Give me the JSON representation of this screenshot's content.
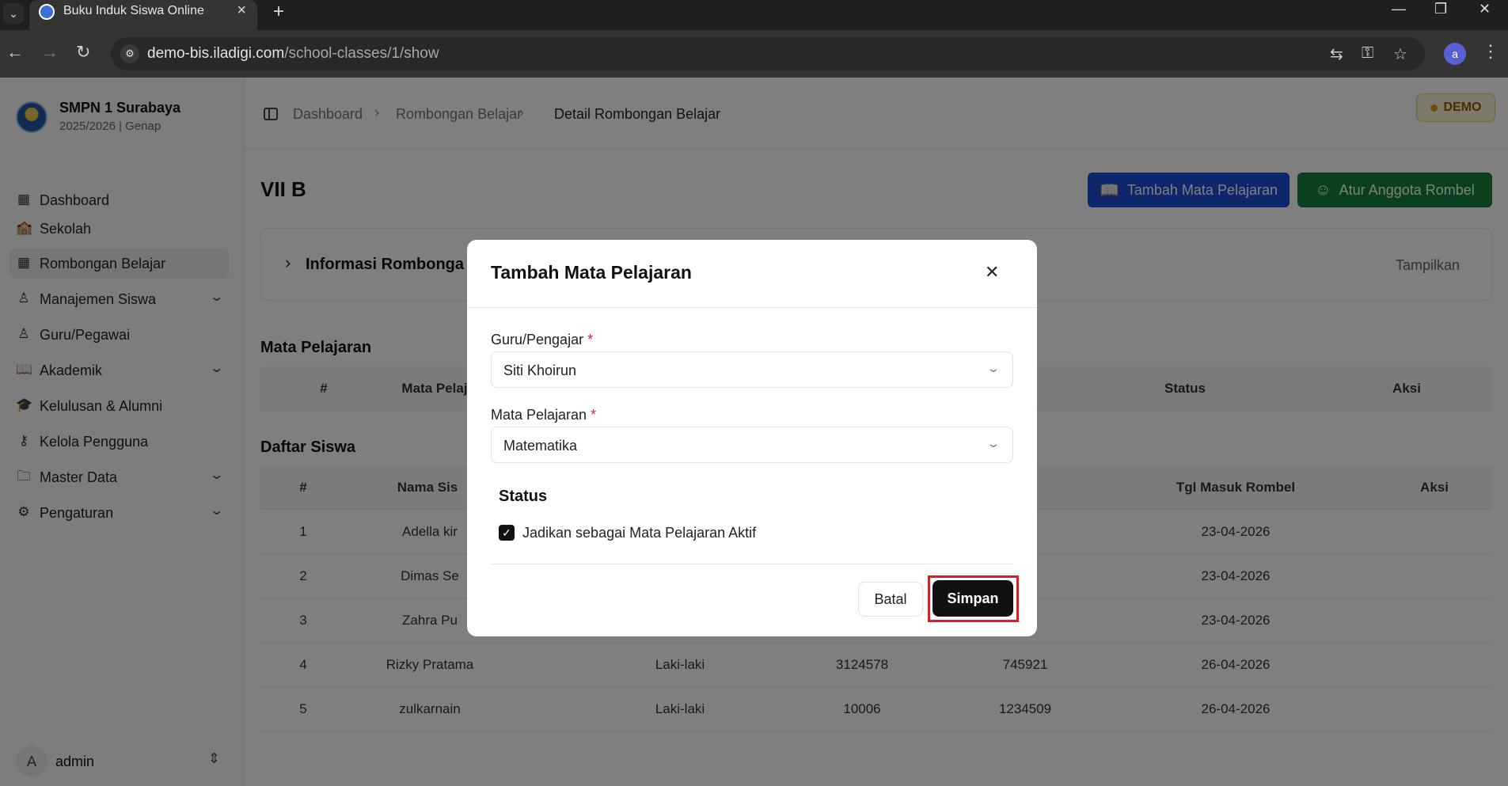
{
  "browser": {
    "tab_title": "Buku Induk Siswa Online",
    "url_host": "demo-bis.iladigi.com",
    "url_path": "/school-classes/1/show",
    "profile_initial": "a"
  },
  "sidebar": {
    "school_name": "SMPN 1 Surabaya",
    "school_year": "2025/2026 | Genap",
    "items": [
      {
        "label": "Dashboard",
        "icon": "grid-icon"
      },
      {
        "label": "Sekolah",
        "icon": "school-icon"
      },
      {
        "label": "Rombongan Belajar",
        "icon": "grid-icon"
      },
      {
        "label": "Manajemen Siswa",
        "icon": "user-icon"
      },
      {
        "label": "Guru/Pegawai",
        "icon": "users-icon"
      },
      {
        "label": "Akademik",
        "icon": "book-icon"
      },
      {
        "label": "Kelulusan & Alumni",
        "icon": "graduation-cap-icon"
      },
      {
        "label": "Kelola Pengguna",
        "icon": "user-key-icon"
      },
      {
        "label": "Master Data",
        "icon": "folder-icon"
      },
      {
        "label": "Pengaturan",
        "icon": "gear-icon"
      }
    ],
    "user_initial": "A",
    "user_name": "admin"
  },
  "header": {
    "breadcrumb": [
      "Dashboard",
      "Rombongan Belajar",
      "Detail Rombongan Belajar"
    ],
    "demo_badge": "DEMO"
  },
  "page": {
    "title": "VII B",
    "add_subject_button": "Tambah Mata Pelajaran",
    "manage_members_button": "Atur Anggota Rombel",
    "info_title": "Informasi Rombonga",
    "info_toggle": "Tampilkan"
  },
  "subjects_section": {
    "title": "Mata Pelajaran",
    "columns": [
      "#",
      "Mata Pelaj",
      "Status",
      "Aksi"
    ]
  },
  "students_section": {
    "title": "Daftar Siswa",
    "columns": [
      "#",
      "Nama Sis",
      "Tgl Masuk Rombel",
      "Aksi"
    ],
    "rows": [
      {
        "no": "1",
        "name": "Adella kir",
        "gender": "",
        "nis": "",
        "nisn": "",
        "date": "23-04-2026"
      },
      {
        "no": "2",
        "name": "Dimas Se",
        "gender": "",
        "nis": "",
        "nisn": "",
        "date": "23-04-2026"
      },
      {
        "no": "3",
        "name": "Zahra Pu",
        "gender": "",
        "nis": "",
        "nisn": "",
        "date": "23-04-2026"
      },
      {
        "no": "4",
        "name": "Rizky Pratama",
        "gender": "Laki-laki",
        "nis": "3124578",
        "nisn": "745921",
        "date": "26-04-2026"
      },
      {
        "no": "5",
        "name": "zulkarnain",
        "gender": "Laki-laki",
        "nis": "10006",
        "nisn": "1234509",
        "date": "26-04-2026"
      }
    ]
  },
  "modal": {
    "title": "Tambah Mata Pelajaran",
    "teacher_label": "Guru/Pengajar",
    "teacher_value": "Siti Khoirun",
    "subject_label": "Mata Pelajaran",
    "subject_value": "Matematika",
    "required_mark": "*",
    "status_title": "Status",
    "active_checkbox_label": "Jadikan sebagai Mata Pelajaran Aktif",
    "active_checked": true,
    "cancel_button": "Batal",
    "save_button": "Simpan"
  },
  "colors": {
    "primary_blue": "#1d4ed8",
    "primary_green": "#15803d",
    "highlight_red": "#d81e2a"
  }
}
